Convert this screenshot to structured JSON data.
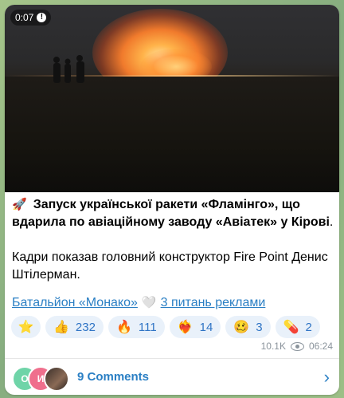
{
  "video": {
    "duration": "0:07",
    "mute_glyph": "!"
  },
  "post": {
    "rocket_emoji": "🚀",
    "title": "Запуск української ракети «Фламінго», що вдарила по авіаційному заводу «Авіатек» у Кірові",
    "title_end": ".",
    "body": "Кадри показав головний конструктор Fire Point Денис Штілерман."
  },
  "links": {
    "first": "Батальйон «Монако»",
    "heart": "🤍",
    "second": "3 питань реклами"
  },
  "reactions": [
    {
      "emoji": "⭐",
      "count": ""
    },
    {
      "emoji": "👍",
      "count": "232"
    },
    {
      "emoji": "🔥",
      "count": "111"
    },
    {
      "emoji": "❤️‍🔥",
      "count": "14"
    },
    {
      "emoji": "🥴",
      "count": "3"
    },
    {
      "emoji": "💊",
      "count": "2"
    }
  ],
  "meta": {
    "views": "10.1K",
    "time": "06:24"
  },
  "comments": {
    "label": "9 Comments",
    "avatar1": "О",
    "avatar2": "И"
  },
  "colors": {
    "accent": "#2a7fc4",
    "reaction_bg": "#e9f1fa",
    "meta": "#8b949c"
  }
}
